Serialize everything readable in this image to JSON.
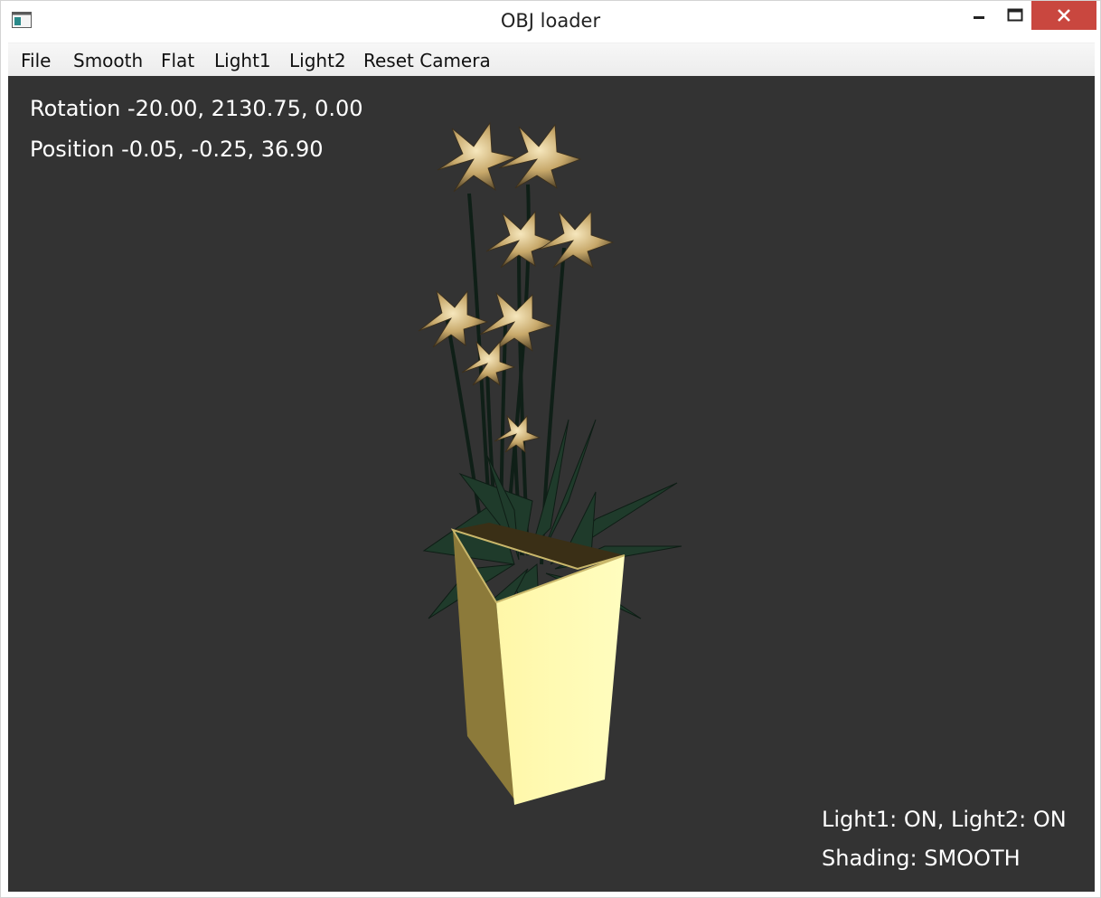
{
  "window": {
    "title": "OBJ loader"
  },
  "titlebar_icons": {
    "app": "app-window-icon",
    "minimize": "minimize-icon",
    "maximize": "maximize-icon",
    "close": "close-icon"
  },
  "menu": {
    "items": [
      {
        "label": "File"
      },
      {
        "label": "Smooth"
      },
      {
        "label": "Flat"
      },
      {
        "label": "Light1"
      },
      {
        "label": "Light2"
      },
      {
        "label": "Reset Camera"
      }
    ]
  },
  "viewport": {
    "background": "#333333",
    "rotation_text": "Rotation -20.00, 2130.75, 0.00",
    "position_text": "Position -0.05, -0.25, 36.90",
    "lights_text": "Light1: ON, Light2: ON",
    "shading_text": "Shading: SMOOTH"
  },
  "colors": {
    "close_button": "#c9473f",
    "text": "#ffffff",
    "pot_light": "#fffcb0",
    "pot_dark": "#8a7d3e",
    "leaf": "#1e3a2a",
    "flower": "#c8ad73"
  }
}
